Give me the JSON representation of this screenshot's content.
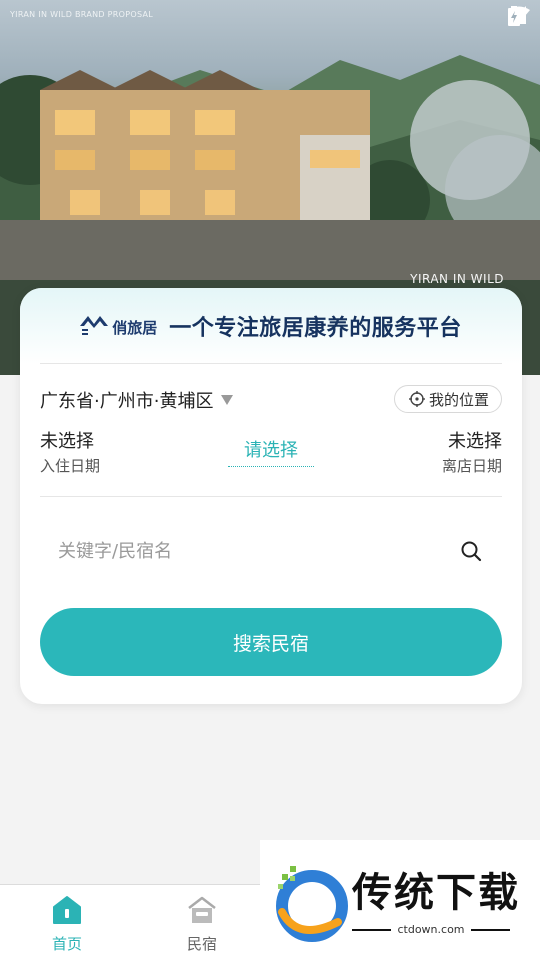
{
  "hero": {
    "caption_top": "YIRAN IN WILD BRAND PROPOSAL",
    "caption_bottom": "YIRAN IN WILD"
  },
  "status_bar": {
    "icons": [
      "wifi-icon",
      "signal-icon",
      "battery-charging-icon"
    ]
  },
  "card": {
    "brand_name": "俏旅居",
    "slogan": "一个专注旅居康养的服务平台",
    "region": "广东省·广州市·黄埔区",
    "my_location_label": "我的位置",
    "checkin": {
      "value": "未选择",
      "label": "入住日期"
    },
    "select_prompt": "请选择",
    "checkout": {
      "value": "未选择",
      "label": "离店日期"
    },
    "search_placeholder": "关键字/民宿名",
    "search_button": "搜索民宿"
  },
  "tabbar": {
    "items": [
      {
        "label": "首页",
        "icon": "home-icon",
        "active": true
      },
      {
        "label": "民宿",
        "icon": "house-icon",
        "active": false
      }
    ]
  },
  "watermark": {
    "text": "传统下载",
    "domain": "ctdown.com"
  },
  "colors": {
    "accent": "#2bb7ba",
    "brand_navy": "#16335f"
  }
}
